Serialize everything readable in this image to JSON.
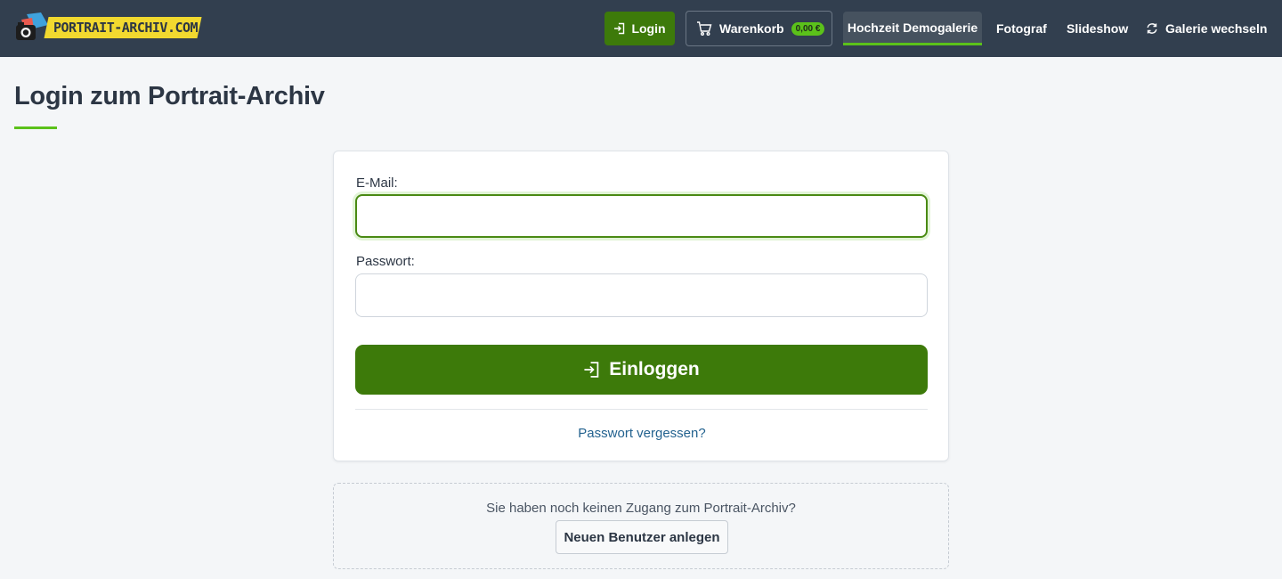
{
  "header": {
    "logo_text": "PORTRAIT-ARCHIV.COM",
    "login_label": "Login",
    "cart_label": "Warenkorb",
    "cart_total": "0,00 €",
    "nav": {
      "active_gallery": "Hochzeit Demogalerie",
      "photographer": "Fotograf",
      "slideshow": "Slideshow",
      "switch_gallery": "Galerie wechseln"
    }
  },
  "page": {
    "title": "Login zum Portrait-Archiv"
  },
  "form": {
    "email_label": "E-Mail:",
    "email_value": "",
    "password_label": "Passwort:",
    "password_value": "",
    "submit_label": "Einloggen",
    "forgot_label": "Passwort vergessen?"
  },
  "register": {
    "prompt": "Sie haben noch keinen Zugang zum Portrait-Archiv?",
    "button_label": "Neuen Benutzer anlegen"
  },
  "colors": {
    "header_bg": "#323f4f",
    "primary_green": "#3d7a0a",
    "accent_green": "#5bc11a",
    "link_blue": "#23628f",
    "logo_yellow": "#f2d92f"
  },
  "icons": {
    "login": "sign-in-icon",
    "cart": "shopping-cart-icon",
    "switch_gallery": "refresh-icon",
    "submit": "sign-in-icon"
  }
}
